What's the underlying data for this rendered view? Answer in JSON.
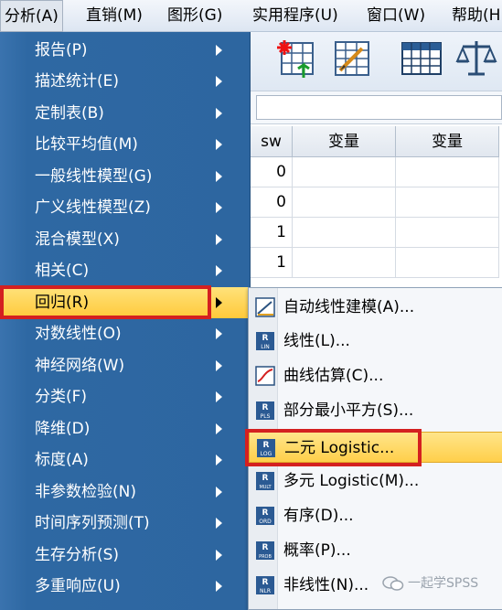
{
  "menubar": {
    "items": [
      "分析(A)",
      "直销(M)",
      "图形(G)",
      "实用程序(U)",
      "窗口(W)",
      "帮助(H"
    ]
  },
  "grid": {
    "headers": [
      "sw",
      "变量",
      "变量"
    ],
    "rows": [
      "0",
      "0",
      "1",
      "1"
    ]
  },
  "analyze_menu": {
    "items": [
      "报告(P)",
      "描述统计(E)",
      "定制表(B)",
      "比较平均值(M)",
      "一般线性模型(G)",
      "广义线性模型(Z)",
      "混合模型(X)",
      "相关(C)",
      "回归(R)",
      "对数线性(O)",
      "神经网络(W)",
      "分类(F)",
      "降维(D)",
      "标度(A)",
      "非参数检验(N)",
      "时间序列预测(T)",
      "生存分析(S)",
      "多重响应(U)"
    ],
    "selected_index": 8
  },
  "regression_menu": {
    "items": [
      {
        "label": "自动线性建模(A)...",
        "icon": "auto-linear-icon"
      },
      {
        "label": "线性(L)...",
        "icon": "linear-lin-icon",
        "tag": "LIN"
      },
      {
        "label": "曲线估算(C)...",
        "icon": "curve-estimation-icon"
      },
      {
        "label": "部分最小平方(S)...",
        "icon": "pls-icon",
        "tag": "PLS"
      },
      {
        "label": "二元 Logistic...",
        "icon": "binary-logistic-icon",
        "tag": "LOG"
      },
      {
        "label": "多元 Logistic(M)...",
        "icon": "multinomial-logistic-icon",
        "tag": "MULT"
      },
      {
        "label": "有序(D)...",
        "icon": "ordinal-icon",
        "tag": "ORD"
      },
      {
        "label": "概率(P)...",
        "icon": "probit-icon",
        "tag": "PROB"
      },
      {
        "label": "非线性(N)...",
        "icon": "nonlinear-icon",
        "tag": "NLR"
      }
    ],
    "selected_index": 4
  },
  "watermark": "一起学SPSS",
  "colors": {
    "menu_bg": "#2d66a0",
    "highlight": "#ffc93a",
    "annotation_red": "#d42020"
  }
}
